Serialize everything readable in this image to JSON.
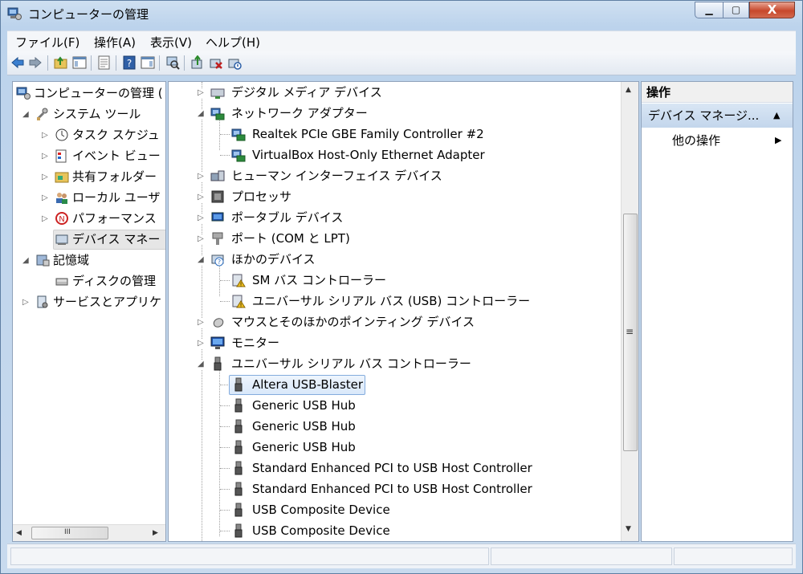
{
  "window": {
    "title": "コンピューターの管理",
    "controls": {
      "minimize": "▁",
      "maximize": "▢",
      "close": "X"
    }
  },
  "menu": [
    "ファイル(F)",
    "操作(A)",
    "表示(V)",
    "ヘルプ(H)"
  ],
  "toolbar": [
    "back-icon",
    "forward-icon",
    "up-folder-icon",
    "show-tree-icon",
    "properties-icon",
    "help-icon",
    "action-pane-icon",
    "scan-hardware-icon",
    "update-driver-icon",
    "uninstall-icon",
    "disable-icon"
  ],
  "left_tree": [
    {
      "label": "コンピューターの管理 (",
      "level": 0,
      "expander": "",
      "icon": "computer-management-icon"
    },
    {
      "label": "システム ツール",
      "level": 1,
      "expander": "◢",
      "icon": "system-tools-icon"
    },
    {
      "label": "タスク スケジュ",
      "level": 2,
      "expander": "▷",
      "icon": "task-scheduler-icon"
    },
    {
      "label": "イベント ビュー",
      "level": 2,
      "expander": "▷",
      "icon": "event-viewer-icon"
    },
    {
      "label": "共有フォルダー",
      "level": 2,
      "expander": "▷",
      "icon": "shared-folder-icon"
    },
    {
      "label": "ローカル ユーザ",
      "level": 2,
      "expander": "▷",
      "icon": "local-users-icon"
    },
    {
      "label": "パフォーマンス",
      "level": 2,
      "expander": "▷",
      "icon": "performance-icon"
    },
    {
      "label": "デバイス マネー",
      "level": 2,
      "expander": "",
      "icon": "device-manager-icon",
      "selected": true
    },
    {
      "label": "記憶域",
      "level": 1,
      "expander": "◢",
      "icon": "storage-icon"
    },
    {
      "label": "ディスクの管理",
      "level": 2,
      "expander": "",
      "icon": "disk-management-icon"
    },
    {
      "label": "サービスとアプリケ",
      "level": 1,
      "expander": "▷",
      "icon": "services-icon"
    }
  ],
  "device_tree": [
    {
      "label": "デジタル メディア デバイス",
      "level": 0,
      "expander": "▷",
      "icon": "media-device-icon"
    },
    {
      "label": "ネットワーク アダプター",
      "level": 0,
      "expander": "◢",
      "icon": "network-adapter-icon"
    },
    {
      "label": "Realtek PCIe GBE Family Controller #2",
      "level": 1,
      "icon": "network-adapter-icon"
    },
    {
      "label": "VirtualBox Host-Only Ethernet Adapter",
      "level": 1,
      "icon": "network-adapter-icon"
    },
    {
      "label": "ヒューマン インターフェイス デバイス",
      "level": 0,
      "expander": "▷",
      "icon": "hid-icon"
    },
    {
      "label": "プロセッサ",
      "level": 0,
      "expander": "▷",
      "icon": "processor-icon"
    },
    {
      "label": "ポータブル デバイス",
      "level": 0,
      "expander": "▷",
      "icon": "portable-device-icon"
    },
    {
      "label": "ポート (COM と LPT)",
      "level": 0,
      "expander": "▷",
      "icon": "port-icon"
    },
    {
      "label": "ほかのデバイス",
      "level": 0,
      "expander": "◢",
      "icon": "unknown-device-icon"
    },
    {
      "label": "SM バス コントローラー",
      "level": 1,
      "icon": "unknown-device-warning-icon"
    },
    {
      "label": "ユニバーサル シリアル バス (USB) コントローラー",
      "level": 1,
      "icon": "unknown-device-warning-icon"
    },
    {
      "label": "マウスとそのほかのポインティング デバイス",
      "level": 0,
      "expander": "▷",
      "icon": "mouse-icon"
    },
    {
      "label": "モニター",
      "level": 0,
      "expander": "▷",
      "icon": "monitor-icon"
    },
    {
      "label": "ユニバーサル シリアル バス コントローラー",
      "level": 0,
      "expander": "◢",
      "icon": "usb-icon"
    },
    {
      "label": "Altera USB-Blaster",
      "level": 1,
      "icon": "usb-icon",
      "selected": true
    },
    {
      "label": "Generic USB Hub",
      "level": 1,
      "icon": "usb-icon"
    },
    {
      "label": "Generic USB Hub",
      "level": 1,
      "icon": "usb-icon"
    },
    {
      "label": "Generic USB Hub",
      "level": 1,
      "icon": "usb-icon"
    },
    {
      "label": "Standard Enhanced PCI to USB Host Controller",
      "level": 1,
      "icon": "usb-icon"
    },
    {
      "label": "Standard Enhanced PCI to USB Host Controller",
      "level": 1,
      "icon": "usb-icon"
    },
    {
      "label": "USB Composite Device",
      "level": 1,
      "icon": "usb-icon"
    },
    {
      "label": "USB Composite Device",
      "level": 1,
      "icon": "usb-icon"
    }
  ],
  "actions": {
    "header": "操作",
    "section": "デバイス マネージ...",
    "section_toggle": "▲",
    "more": "他の操作",
    "more_arrow": "▶"
  },
  "scroll": {
    "up": "▲",
    "down": "▼",
    "left": "◀",
    "right": "▶",
    "grip_v": "≡",
    "grip_h": "III"
  }
}
